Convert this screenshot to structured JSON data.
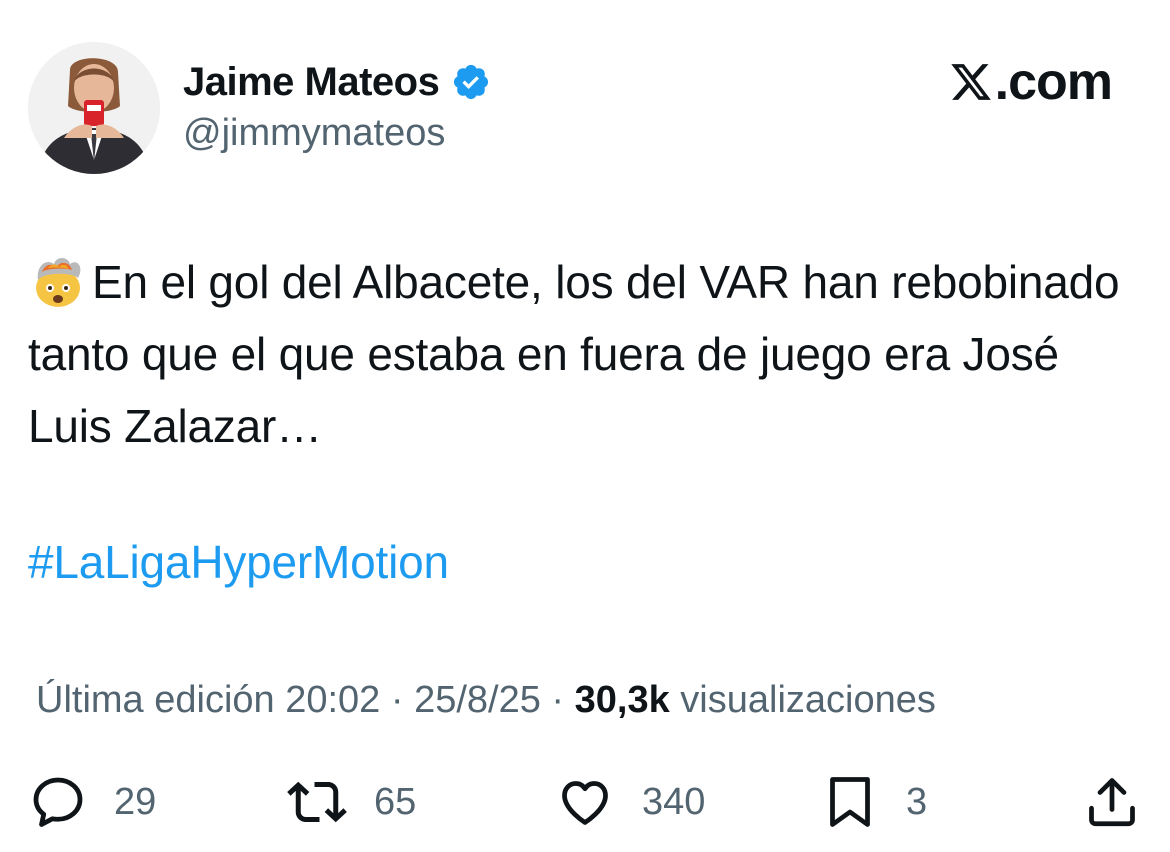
{
  "author": {
    "display_name": "Jaime Mateos",
    "handle": "@jimmymateos",
    "verified": true,
    "avatar_icon": "profile-photo"
  },
  "brand": {
    "logo_icon": "x-logo-icon",
    "domain": ".com"
  },
  "tweet": {
    "emoji_icon": "exploding-head-emoji",
    "text": "En el gol del Albacete, los del VAR han rebobinado tanto que el que estaba en fuera de juego era José Luis Zalazar…",
    "hashtag": "#LaLigaHyperMotion"
  },
  "meta": {
    "edited_label": "Última edición 20:02 · 25/8/25",
    "separator": " · ",
    "views_count": "30,3k",
    "views_label": " visualizaciones"
  },
  "actions": {
    "replies": "29",
    "reposts": "65",
    "likes": "340",
    "bookmarks": "3"
  },
  "colors": {
    "text_primary": "#0f1419",
    "text_secondary": "#536471",
    "link": "#1d9bf0",
    "verified_badge": "#1d9bf0"
  }
}
